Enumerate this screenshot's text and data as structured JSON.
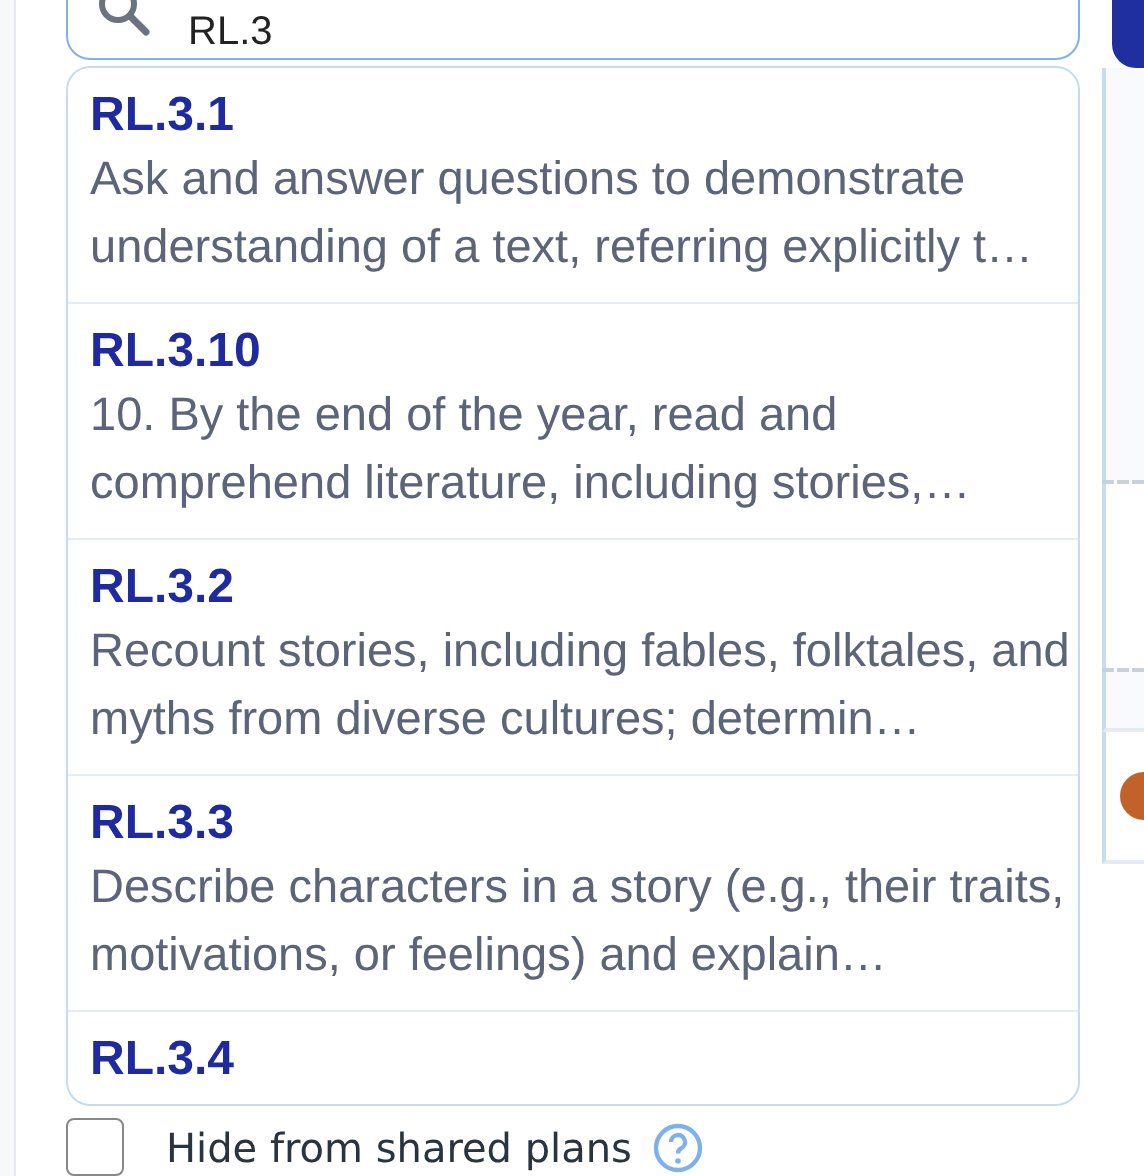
{
  "search": {
    "value": "RL.3"
  },
  "suggestions": [
    {
      "code": "RL.3.1",
      "description": "Ask and answer questions to demonstrate understanding of a text, referring explicitly t…"
    },
    {
      "code": "RL.3.10",
      "description": "10. By the end of the year, read and comprehend literature, including stories,…"
    },
    {
      "code": "RL.3.2",
      "description": "Recount stories, including fables, folktales, and myths from diverse cultures; determin…"
    },
    {
      "code": "RL.3.3",
      "description": "Describe characters in a story (e.g., their traits, motivations, or feelings) and explain…"
    },
    {
      "code": "RL.3.4"
    }
  ],
  "hide_from_shared_plans": {
    "label": "Hide from shared plans",
    "checked": false
  }
}
